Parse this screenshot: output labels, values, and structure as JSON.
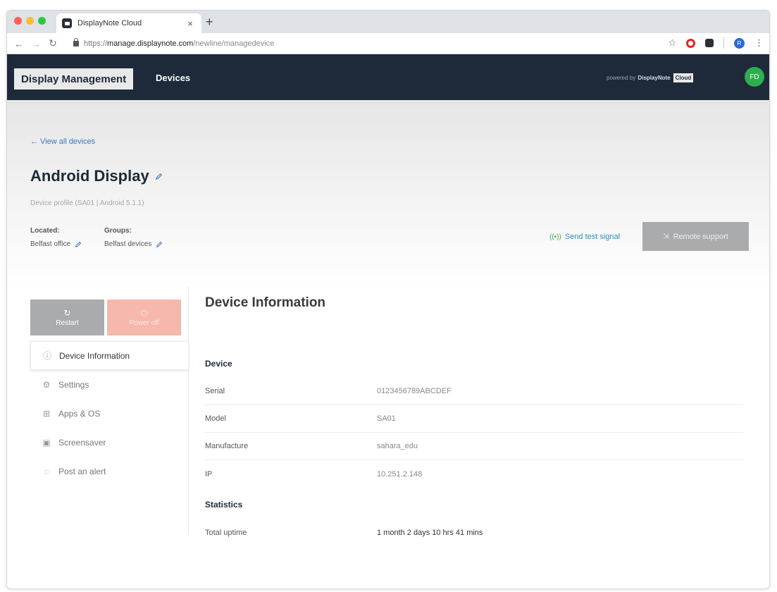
{
  "browser": {
    "tab_title": "DisplayNote Cloud",
    "tab_close": "×",
    "new_tab": "+",
    "url_scheme": "https://",
    "url_host": "manage.displaynote.com",
    "url_path": "/newline/managedevice",
    "profile_initial": "R",
    "traffic_colors": [
      "#ff5f57",
      "#febc2e",
      "#28c840"
    ]
  },
  "header": {
    "brand": "Display Management",
    "nav_devices": "Devices",
    "powered_by": "powered by",
    "powered_brand": "DisplayNote",
    "cloud_badge": "Cloud",
    "avatar_initials": "FD"
  },
  "hero": {
    "back_link": "← View all devices",
    "title": "Android Display",
    "profile_line": "Device profile (SA01 | Android 5.1.1)",
    "located_label": "Located:",
    "located_value": "Belfast office",
    "groups_label": "Groups:",
    "groups_value": "Belfast devices",
    "test_signal": "Send test signal",
    "remote_support": "Remote support"
  },
  "sidebar": {
    "restart": "Restart",
    "power_off": "Power off",
    "items": [
      {
        "label": "Device Information",
        "icon": "info-icon"
      },
      {
        "label": "Settings",
        "icon": "gear-icon"
      },
      {
        "label": "Apps & OS",
        "icon": "grid-icon"
      },
      {
        "label": "Screensaver",
        "icon": "image-icon"
      },
      {
        "label": "Post an alert",
        "icon": "chat-bubble-icon"
      }
    ]
  },
  "main": {
    "section_title": "Device Information",
    "device_group": "Device",
    "device_rows": [
      {
        "key": "Serial",
        "value": "0123456789ABCDEF"
      },
      {
        "key": "Model",
        "value": "SA01"
      },
      {
        "key": "Manufacture",
        "value": "sahara_edu"
      },
      {
        "key": "IP",
        "value": "10.251.2.148"
      }
    ],
    "stats_group": "Statistics",
    "stats_rows": [
      {
        "key": "Total uptime",
        "value": "1 month 2 days 10 hrs 41 mins"
      }
    ]
  },
  "colors": {
    "header_bg": "#1e2a3a",
    "accent_green": "#2fae4e",
    "link_blue": "#3a78c2",
    "power_off_bg": "#f6b8ab",
    "disabled_gray": "#a9abad"
  }
}
